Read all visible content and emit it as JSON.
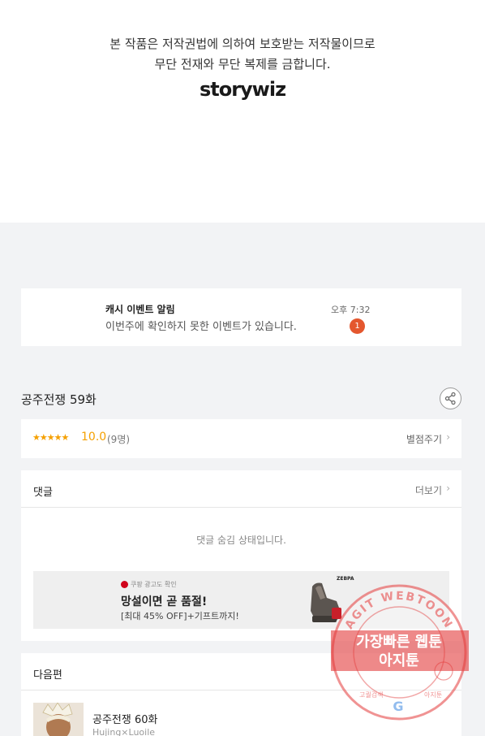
{
  "copyright": {
    "line1": "본 작품은 저작권법에 의하여 보호받는 저작물이므로",
    "line2": "무단 전재와 무단 복제를 금합니다.",
    "logo": "storywiz"
  },
  "notice": {
    "title": "캐시 이벤트 알림",
    "body": "이번주에 확인하지 못한 이벤트가 있습니다.",
    "time": "오후 7:32",
    "badge": "1"
  },
  "episode": {
    "title": "공주전쟁 59화",
    "share_icon": "share-icon"
  },
  "rating": {
    "stars": "★★★★★",
    "score": "10.0",
    "count": "(9명)",
    "give_label": "별점주기"
  },
  "comments": {
    "header": "댓글",
    "more_label": "더보기",
    "hidden_message": "댓글 숨김 상태입니다."
  },
  "ad": {
    "tag": "쿠팡 광고도 확인",
    "headline": "망설이면 곧 품절!",
    "subline": "[최대 45% OFF]+기프트까지!",
    "brand": "ZEBPA"
  },
  "next_episode": {
    "header": "다음편",
    "title": "공주전쟁 60화",
    "author": "Hujing×Luoile"
  },
  "watermark": {
    "ring_text": "AGIT WEBTOON",
    "main_line1": "가장빠른 웹툰",
    "main_line2": "아지툰",
    "bottom_left": "고퀄검색",
    "bottom_right": "아지툰"
  },
  "colors": {
    "accent_star": "#f5a000",
    "badge": "#e4572e",
    "stamp": "#e33b3b"
  }
}
